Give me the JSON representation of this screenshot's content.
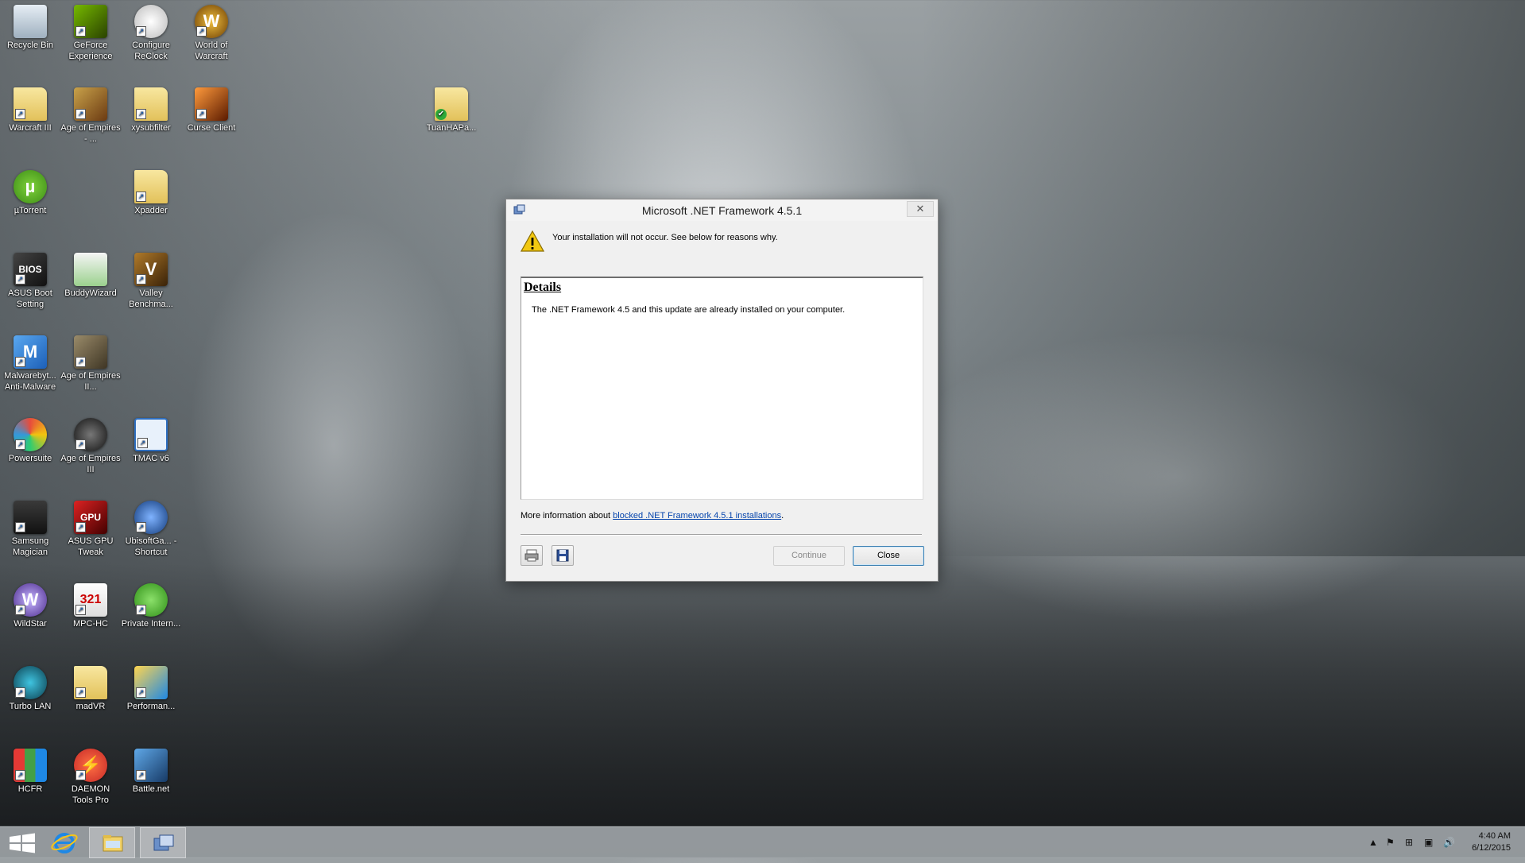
{
  "desktop": {
    "icons": [
      {
        "label": "Recycle Bin",
        "icon": "recycle-bin-icon"
      },
      {
        "label": "GeForce Experience",
        "icon": "geforce-icon"
      },
      {
        "label": "Configure ReClock",
        "icon": "clock-icon"
      },
      {
        "label": "World of Warcraft",
        "icon": "wow-icon"
      },
      {
        "label": "Warcraft III",
        "icon": "folder-icon"
      },
      {
        "label": "Age of Empires - ...",
        "icon": "aoe-icon"
      },
      {
        "label": "xysubfilter",
        "icon": "folder-icon"
      },
      {
        "label": "Curse Client",
        "icon": "curse-icon"
      },
      {
        "label": "TuanHAPa...",
        "icon": "folder-icon"
      },
      {
        "label": "µTorrent",
        "icon": "utorrent-icon"
      },
      {
        "label": "Xpadder",
        "icon": "folder-icon"
      },
      {
        "label": "ASUS Boot Setting",
        "icon": "bios-icon"
      },
      {
        "label": "BuddyWizard",
        "icon": "buddywizard-icon"
      },
      {
        "label": "Valley Benchma...",
        "icon": "valley-icon"
      },
      {
        "label": "Malwarebyt... Anti-Malware",
        "icon": "malwarebytes-icon"
      },
      {
        "label": "Age of Empires II...",
        "icon": "aoe2-icon"
      },
      {
        "label": "Powersuite",
        "icon": "powersuite-icon"
      },
      {
        "label": "Age of Empires III",
        "icon": "aoe3-icon"
      },
      {
        "label": "TMAC v6",
        "icon": "tmac-icon"
      },
      {
        "label": "Samsung Magician",
        "icon": "samsung-icon"
      },
      {
        "label": "ASUS GPU Tweak",
        "icon": "gputweak-icon"
      },
      {
        "label": "UbisoftGa... - Shortcut",
        "icon": "uplay-icon"
      },
      {
        "label": "WildStar",
        "icon": "wildstar-icon"
      },
      {
        "label": "MPC-HC",
        "icon": "mpchc-icon"
      },
      {
        "label": "Private Intern...",
        "icon": "pia-icon"
      },
      {
        "label": "Turbo LAN",
        "icon": "turbolan-icon"
      },
      {
        "label": "madVR",
        "icon": "folder-icon"
      },
      {
        "label": "Performan...",
        "icon": "performance-icon"
      },
      {
        "label": "HCFR",
        "icon": "hcfr-icon"
      },
      {
        "label": "DAEMON Tools Pro",
        "icon": "daemon-icon"
      },
      {
        "label": "Battle.net",
        "icon": "battlenet-icon"
      }
    ]
  },
  "dialog": {
    "title": "Microsoft .NET Framework 4.5.1",
    "close_glyph": "✕",
    "warning_text": "Your installation will not occur. See below for reasons why.",
    "details_heading": "Details",
    "details_text": "The .NET Framework 4.5 and this update are already installed on your computer.",
    "more_info_prefix": "More information about ",
    "more_info_link": "blocked .NET Framework 4.5.1 installations",
    "more_info_suffix": ".",
    "continue_label": "Continue",
    "close_label": "Close"
  },
  "taskbar": {
    "clock_time": "4:40 AM",
    "clock_date": "6/12/2015"
  },
  "colors": {
    "link": "#0645ad",
    "warning_yellow": "#f2c811"
  }
}
